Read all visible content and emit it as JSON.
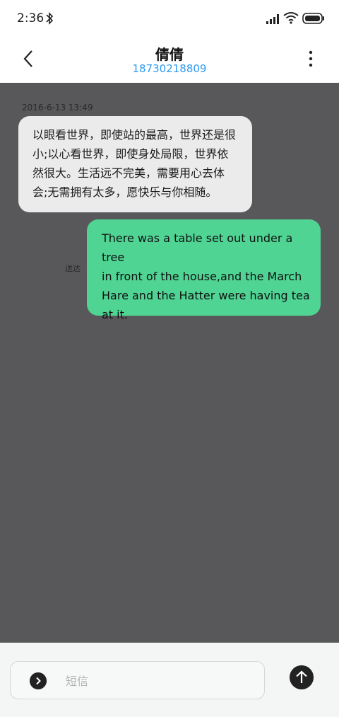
{
  "status_bar": {
    "time": "2:36",
    "icons": [
      "bluetooth-icon",
      "signal-icon",
      "wifi-icon",
      "battery-icon"
    ]
  },
  "header": {
    "contact_name": "倩倩",
    "contact_number": "18730218809",
    "icons": [
      "back-arrow-icon",
      "more-vertical-icon"
    ]
  },
  "conversation": {
    "timestamp": "2016-6-13 13:49",
    "received_lines": [
      "以眼看世界，即使站的最高，世界还是很",
      "小;以心看世界，即使身处局限，世界依",
      "然很大。生活远不完美，需要用心去体",
      "会;无需拥有太多，愿快乐与你相随。"
    ],
    "sent_lines": [
      "There was a table set out under a tree",
      "in front of the house,and the March",
      "Hare and the Hatter were having tea",
      "at it."
    ],
    "delivery_status": "送达"
  },
  "composer": {
    "placeholder": "短信",
    "icons": [
      "chevron-right-icon",
      "send-arrow-icon"
    ]
  },
  "colors": {
    "chat_background": "#58585a",
    "received_bubble": "#ebebeb",
    "sent_bubble": "#4fd494",
    "number_accent": "#2d9bf0"
  }
}
